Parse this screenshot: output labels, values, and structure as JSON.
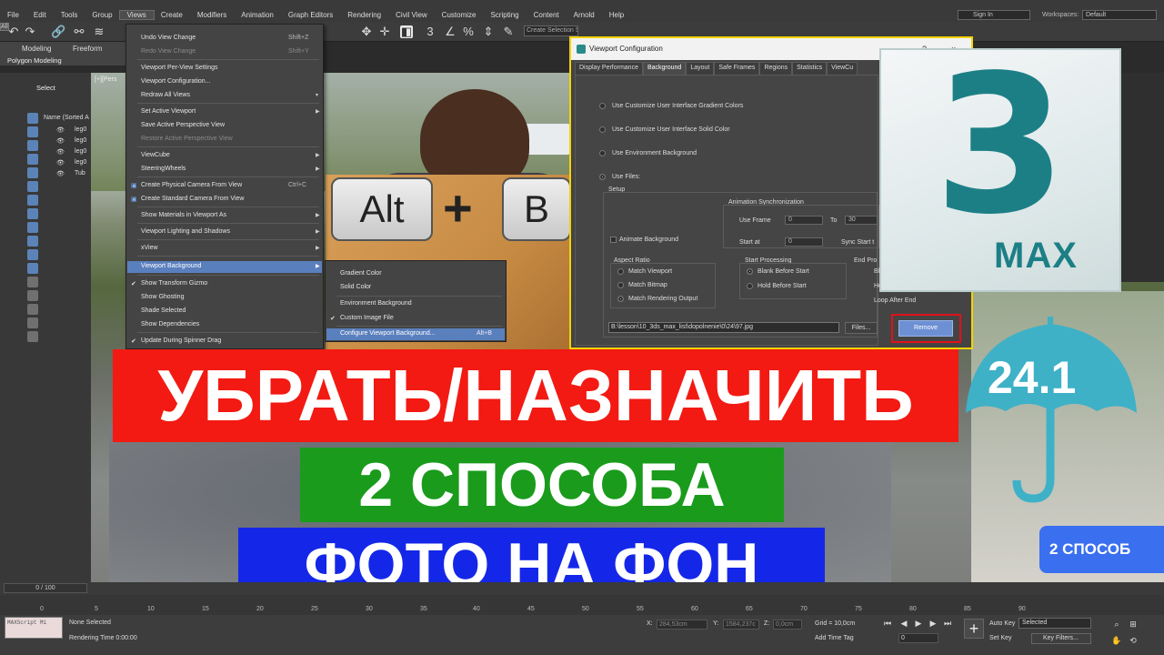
{
  "menu": {
    "items": [
      "File",
      "Edit",
      "Tools",
      "Group",
      "Views",
      "Create",
      "Modifiers",
      "Animation",
      "Graph Editors",
      "Rendering",
      "Civil View",
      "Customize",
      "Scripting",
      "Content",
      "Arnold",
      "Help"
    ],
    "sign_in": "Sign In",
    "workspaces_label": "Workspaces:",
    "workspaces_value": "Default"
  },
  "toolbar": {
    "all_filter": "All",
    "selection_set": "Create Selection Se"
  },
  "ribbon": {
    "tabs": [
      "Modeling",
      "Freeform"
    ],
    "sub": "Polygon Modeling"
  },
  "scene_explorer": {
    "select_label": "Select",
    "header": "Name (Sorted A",
    "rows": [
      "leg0",
      "leg0",
      "leg0",
      "leg0",
      "Tub"
    ]
  },
  "viewport": {
    "label": "[+][Pers"
  },
  "views_menu": {
    "items": [
      {
        "label": "Undo View Change",
        "key": "Shift+Z"
      },
      {
        "label": "Redo View Change",
        "key": "Shift+Y"
      },
      {
        "label": "Viewport Per-View Settings"
      },
      {
        "label": "Viewport Configuration..."
      },
      {
        "label": "Redraw All Views"
      },
      {
        "label": "Set Active Viewport"
      },
      {
        "label": "Save Active Perspective View"
      },
      {
        "label": "Restore Active Perspective View"
      },
      {
        "label": "ViewCube"
      },
      {
        "label": "SteeringWheels"
      },
      {
        "label": "Create Physical Camera From View",
        "key": "Ctrl+C"
      },
      {
        "label": "Create Standard Camera From View"
      },
      {
        "label": "Show Materials in Viewport As"
      },
      {
        "label": "Viewport Lighting and Shadows"
      },
      {
        "label": "xView"
      },
      {
        "label": "Viewport Background"
      },
      {
        "label": "Show Transform Gizmo"
      },
      {
        "label": "Show Ghosting"
      },
      {
        "label": "Shade Selected"
      },
      {
        "label": "Show Dependencies"
      },
      {
        "label": "Update During Spinner Drag"
      }
    ]
  },
  "bg_submenu": {
    "items": [
      "Gradient Color",
      "Solid Color",
      "Environment Background",
      "Custom Image File",
      "Configure Viewport Background..."
    ],
    "configure_key": "Alt+B"
  },
  "keys": {
    "alt": "Alt",
    "plus": "+",
    "b": "B"
  },
  "dialog": {
    "title": "Viewport Configuration",
    "help": "?",
    "close": "×",
    "tabs": [
      "Display Performance",
      "Background",
      "Layout",
      "Safe Frames",
      "Regions",
      "Statistics",
      "ViewCu"
    ],
    "opt_gradient": "Use Customize User Interface Gradient Colors",
    "opt_solid": "Use Customize User Interface Solid Color",
    "opt_env": "Use Environment Background",
    "opt_files": "Use Files:",
    "setup": "Setup",
    "anim_sync": "Animation Synchronization",
    "use_frame": "Use Frame",
    "use_frame_val": "0",
    "to": "To",
    "to_val": "30",
    "animate_bg": "Animate Background",
    "start_at": "Start at",
    "start_at_val": "0",
    "sync_start": "Sync Start t",
    "aspect_ratio": "Aspect Ratio",
    "match_viewport": "Match Viewport",
    "match_bitmap": "Match Bitmap",
    "match_render": "Match Rendering Output",
    "start_processing": "Start Processing",
    "blank_before": "Blank Before Start",
    "hold_before": "Hold Before Start",
    "end_proc": "End Pro",
    "end_b": "Bl",
    "end_h": "Ho",
    "loop_after": "Loop After End",
    "path": "B:\\lesson\\10_3ds_max_list\\dopolnenie\\0\\24\\97.jpg",
    "files_btn": "Files...",
    "remove_btn": "Remove"
  },
  "logo": {
    "digit": "3",
    "text": "MAX"
  },
  "version": "24.1",
  "banners": {
    "line1": "УБРАТЬ/НАЗНАЧИТЬ",
    "line2": "2 СПОСОБА",
    "line3": "ФОТО НА ФОН",
    "method": "2 СПОСОБ"
  },
  "timeline": {
    "frame_counter": "0 / 100",
    "ticks": [
      "0",
      "5",
      "10",
      "15",
      "20",
      "25",
      "30",
      "35",
      "40",
      "45",
      "50",
      "55",
      "60",
      "65",
      "70",
      "75",
      "80",
      "85",
      "90"
    ]
  },
  "status": {
    "maxscript": "MAXScript Mi",
    "none_selected": "None Selected",
    "rendering_time": "Rendering Time  0:00:00",
    "x_label": "X:",
    "x_val": "284,53cm",
    "y_label": "Y:",
    "y_val": "1584,237c",
    "z_label": "Z:",
    "z_val": "0,0cm",
    "grid": "Grid = 10,0cm",
    "add_time_tag": "Add Time Tag",
    "auto_key": "Auto Key",
    "set_key": "Set Key",
    "selected": "Selected",
    "key_filters": "Key Filters...",
    "frame_val": "0",
    "colors": {
      "banner_red": "#f21a12",
      "banner_green": "#1a9b1c",
      "banner_blue": "#1427e8",
      "highlight": "#5a7fbd",
      "dialog_border": "#f5d300",
      "logo_teal": "#1d7f86"
    }
  }
}
